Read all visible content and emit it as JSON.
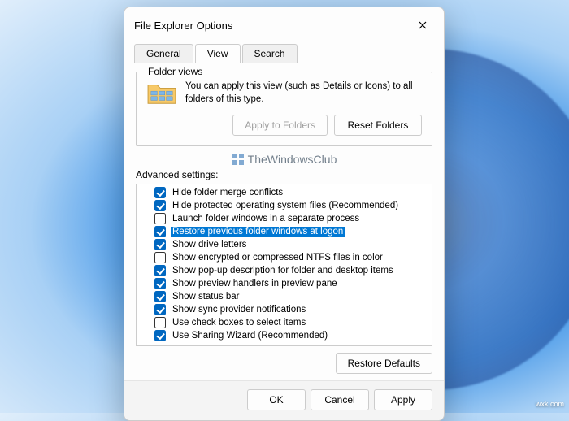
{
  "dialog": {
    "title": "File Explorer Options",
    "tabs": {
      "general": "General",
      "view": "View",
      "search": "Search"
    },
    "activeTab": "view"
  },
  "folderViews": {
    "groupTitle": "Folder views",
    "description": "You can apply this view (such as Details or Icons) to all folders of this type.",
    "applyBtn": "Apply to Folders",
    "resetBtn": "Reset Folders"
  },
  "watermark": "TheWindowsClub",
  "advanced": {
    "label": "Advanced settings:",
    "items": [
      {
        "checked": true,
        "text": "Hide folder merge conflicts",
        "highlighted": false
      },
      {
        "checked": true,
        "text": "Hide protected operating system files (Recommended)",
        "highlighted": false
      },
      {
        "checked": false,
        "text": "Launch folder windows in a separate process",
        "highlighted": false
      },
      {
        "checked": true,
        "text": "Restore previous folder windows at logon",
        "highlighted": true
      },
      {
        "checked": true,
        "text": "Show drive letters",
        "highlighted": false
      },
      {
        "checked": false,
        "text": "Show encrypted or compressed NTFS files in color",
        "highlighted": false
      },
      {
        "checked": true,
        "text": "Show pop-up description for folder and desktop items",
        "highlighted": false
      },
      {
        "checked": true,
        "text": "Show preview handlers in preview pane",
        "highlighted": false
      },
      {
        "checked": true,
        "text": "Show status bar",
        "highlighted": false
      },
      {
        "checked": true,
        "text": "Show sync provider notifications",
        "highlighted": false
      },
      {
        "checked": false,
        "text": "Use check boxes to select items",
        "highlighted": false
      },
      {
        "checked": true,
        "text": "Use Sharing Wizard (Recommended)",
        "highlighted": false
      }
    ]
  },
  "restoreDefaults": "Restore Defaults",
  "buttons": {
    "ok": "OK",
    "cancel": "Cancel",
    "apply": "Apply"
  },
  "corner": "wxk.com"
}
